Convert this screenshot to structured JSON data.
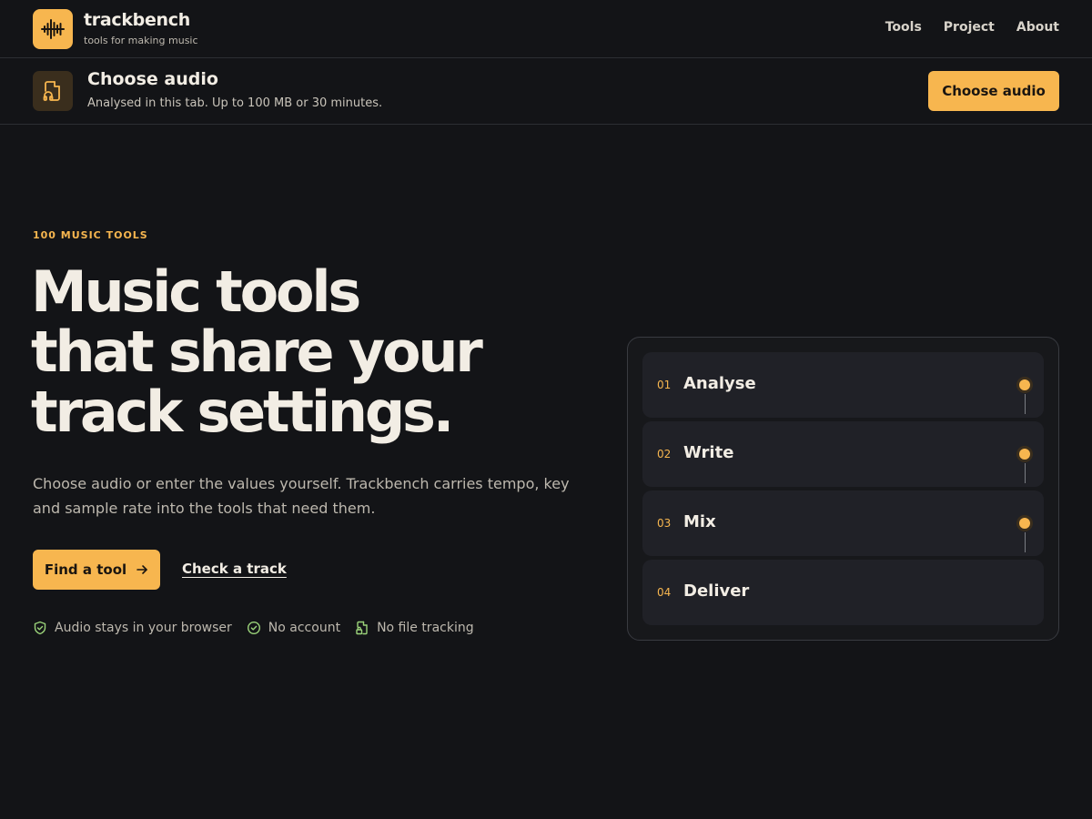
{
  "header": {
    "brand": "trackbench",
    "tagline": "tools for making music",
    "nav": [
      {
        "label": "Tools"
      },
      {
        "label": "Project"
      },
      {
        "label": "About"
      }
    ]
  },
  "upload": {
    "title": "Choose audio",
    "subtitle": "Analysed in this tab. Up to 100 MB or 30 minutes.",
    "button_label": "Choose audio"
  },
  "hero": {
    "eyebrow": "100 MUSIC TOOLS",
    "title_lines": [
      "Music tools",
      "that share your",
      "track settings."
    ],
    "body": "Choose audio or enter the values yourself. Trackbench carries tempo, key and sample rate into the tools that need them.",
    "primary_label": "Find a tool",
    "primary_icon": "arrow-right-icon",
    "secondary_label": "Check a track",
    "badges": [
      {
        "icon": "shield-check-icon",
        "label": "Audio stays in your browser"
      },
      {
        "icon": "circle-check-icon",
        "label": "No account"
      },
      {
        "icon": "file-lock-icon",
        "label": "No file tracking"
      }
    ]
  },
  "steps": [
    {
      "number": "01",
      "label": "Analyse"
    },
    {
      "number": "02",
      "label": "Write"
    },
    {
      "number": "03",
      "label": "Mix"
    },
    {
      "number": "04",
      "label": "Deliver"
    }
  ],
  "colors": {
    "background": "#131417",
    "accent": "#f7b64f",
    "badge_icon": "#9bd37a",
    "text": "#f2ede4"
  }
}
